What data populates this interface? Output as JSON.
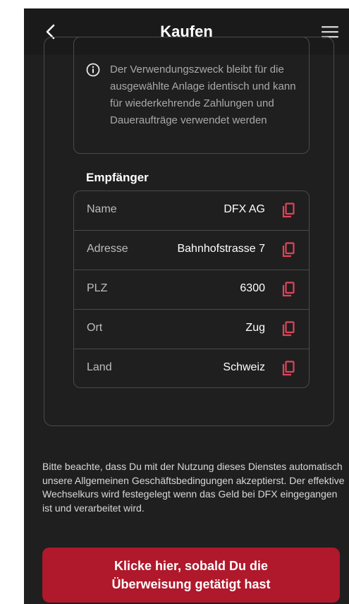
{
  "header": {
    "title": "Kaufen",
    "back_icon": "chevron-left-icon",
    "menu_icon": "hamburger-menu-icon"
  },
  "info": {
    "icon": "info-icon",
    "text": "Der Verwendungszweck bleibt für die ausgewählte Anlage identisch und kann für wiederkehrende Zahlungen und Daueraufträge verwendet werden"
  },
  "recipient": {
    "title": "Empfänger",
    "rows": [
      {
        "label": "Name",
        "value": "DFX AG"
      },
      {
        "label": "Adresse",
        "value": "Bahnhofstrasse 7"
      },
      {
        "label": "PLZ",
        "value": "6300"
      },
      {
        "label": "Ort",
        "value": "Zug"
      },
      {
        "label": "Land",
        "value": "Schweiz"
      }
    ],
    "copy_icon": "copy-icon"
  },
  "terms": {
    "text": "Bitte beachte, dass Du mit der Nutzung dieses Dienstes automatisch unsere Allgemeinen Geschäftsbedingungen akzeptierst. Der effektive Wechselkurs wird festegelegt wenn das Geld bei DFX eingegangen ist und verarbeitet wird."
  },
  "cta": {
    "label": "Klicke hier, sobald Du die Überweisung getätigt hast"
  },
  "colors": {
    "background": "#1f1f1f",
    "accent": "#b0182b",
    "copy_icon": "#e0435a"
  }
}
